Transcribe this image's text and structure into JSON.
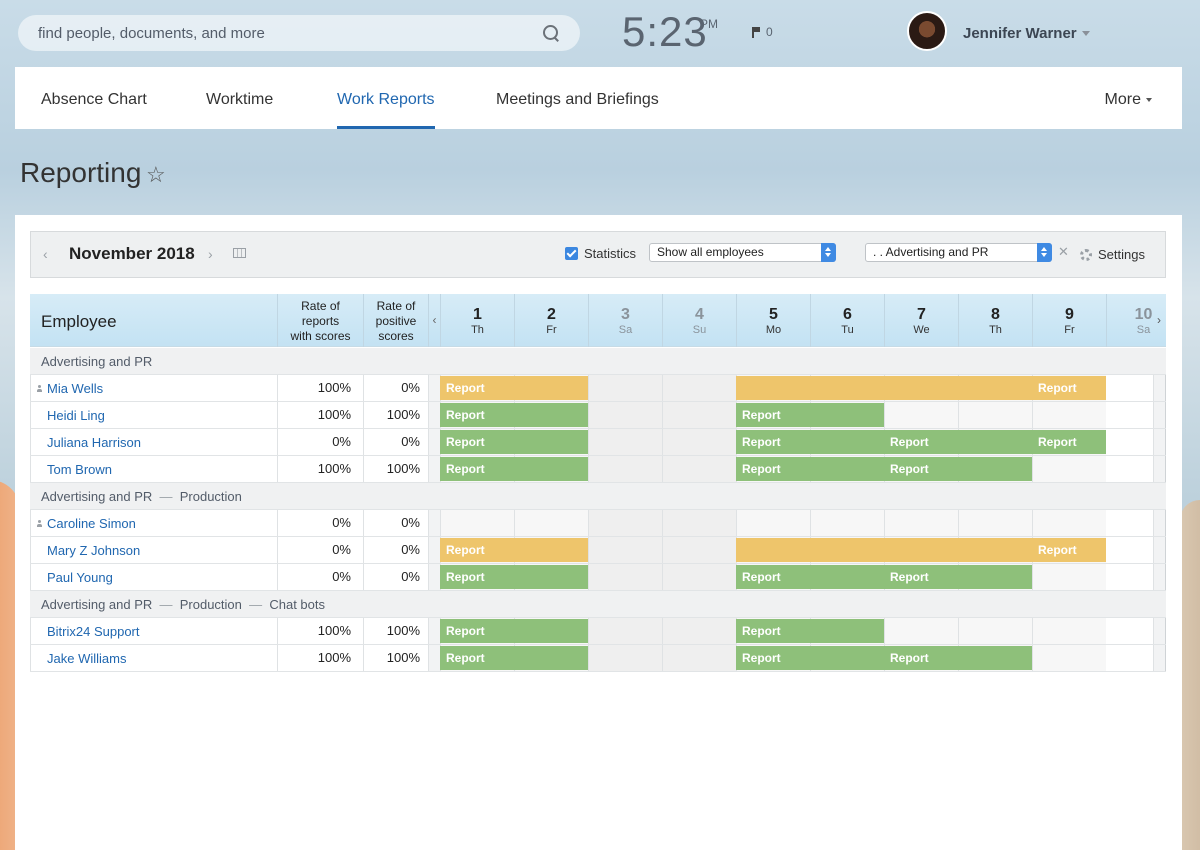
{
  "header": {
    "search_placeholder": "find people, documents, and more",
    "clock_time": "5:23",
    "clock_ampm": "PM",
    "flag_count": "0",
    "user_name": "Jennifer Warner"
  },
  "nav": {
    "tabs": [
      {
        "label": "Absence Chart",
        "active": false
      },
      {
        "label": "Worktime",
        "active": false
      },
      {
        "label": "Work Reports",
        "active": true
      },
      {
        "label": "Meetings and Briefings",
        "active": false
      }
    ],
    "more_label": "More"
  },
  "page": {
    "title": "Reporting"
  },
  "toolbar": {
    "month": "November 2018",
    "statistics_label": "Statistics",
    "statistics_checked": true,
    "employees_select": "Show all employees",
    "department_select": ". . Advertising and PR",
    "settings_label": "Settings"
  },
  "grid": {
    "employee_header": "Employee",
    "col1_header": [
      "Rate of",
      "reports",
      "with scores"
    ],
    "col2_header": [
      "Rate of",
      "positive",
      "scores"
    ],
    "days": [
      {
        "num": "1",
        "name": "Th",
        "weekend": false
      },
      {
        "num": "2",
        "name": "Fr",
        "weekend": false
      },
      {
        "num": "3",
        "name": "Sa",
        "weekend": true
      },
      {
        "num": "4",
        "name": "Su",
        "weekend": true
      },
      {
        "num": "5",
        "name": "Mo",
        "weekend": false
      },
      {
        "num": "6",
        "name": "Tu",
        "weekend": false
      },
      {
        "num": "7",
        "name": "We",
        "weekend": false
      },
      {
        "num": "8",
        "name": "Th",
        "weekend": false
      },
      {
        "num": "9",
        "name": "Fr",
        "weekend": false
      },
      {
        "num": "10",
        "name": "Sa",
        "weekend": true
      }
    ],
    "rows": [
      {
        "type": "group",
        "parts": [
          "Advertising and PR"
        ]
      },
      {
        "type": "emp",
        "name": "Mia Wells",
        "head": true,
        "rate": "100%",
        "positive": "0%",
        "bars": [
          {
            "from": 0,
            "span": 2,
            "color": "yellow",
            "label": "Report"
          },
          {
            "from": 4,
            "span": 4,
            "color": "yellow",
            "label": ""
          },
          {
            "from": 8,
            "span": 1,
            "color": "yellow",
            "label": "Report"
          }
        ]
      },
      {
        "type": "emp",
        "name": "Heidi Ling",
        "head": false,
        "rate": "100%",
        "positive": "100%",
        "bars": [
          {
            "from": 0,
            "span": 2,
            "color": "green",
            "label": "Report"
          },
          {
            "from": 4,
            "span": 2,
            "color": "green",
            "label": "Report"
          }
        ]
      },
      {
        "type": "emp",
        "name": "Juliana Harrison",
        "head": false,
        "rate": "0%",
        "positive": "0%",
        "bars": [
          {
            "from": 0,
            "span": 2,
            "color": "green",
            "label": "Report"
          },
          {
            "from": 4,
            "span": 2,
            "color": "green",
            "label": "Report"
          },
          {
            "from": 6,
            "span": 2,
            "color": "green",
            "label": "Report"
          },
          {
            "from": 8,
            "span": 1,
            "color": "green",
            "label": "Report"
          }
        ]
      },
      {
        "type": "emp",
        "name": "Tom Brown",
        "head": false,
        "rate": "100%",
        "positive": "100%",
        "bars": [
          {
            "from": 0,
            "span": 2,
            "color": "green",
            "label": "Report"
          },
          {
            "from": 4,
            "span": 2,
            "color": "green",
            "label": "Report"
          },
          {
            "from": 6,
            "span": 2,
            "color": "green",
            "label": "Report"
          }
        ]
      },
      {
        "type": "group",
        "parts": [
          "Advertising and PR",
          "Production"
        ]
      },
      {
        "type": "emp",
        "name": "Caroline Simon",
        "head": true,
        "rate": "0%",
        "positive": "0%",
        "bars": []
      },
      {
        "type": "emp",
        "name": "Mary Z Johnson",
        "head": false,
        "rate": "0%",
        "positive": "0%",
        "bars": [
          {
            "from": 0,
            "span": 2,
            "color": "yellow",
            "label": "Report"
          },
          {
            "from": 4,
            "span": 4,
            "color": "yellow",
            "label": ""
          },
          {
            "from": 8,
            "span": 1,
            "color": "yellow",
            "label": "Report"
          }
        ]
      },
      {
        "type": "emp",
        "name": "Paul Young",
        "head": false,
        "rate": "0%",
        "positive": "0%",
        "bars": [
          {
            "from": 0,
            "span": 2,
            "color": "green",
            "label": "Report"
          },
          {
            "from": 4,
            "span": 2,
            "color": "green",
            "label": "Report"
          },
          {
            "from": 6,
            "span": 2,
            "color": "green",
            "label": "Report"
          }
        ]
      },
      {
        "type": "group",
        "parts": [
          "Advertising and PR",
          "Production",
          "Chat bots"
        ]
      },
      {
        "type": "emp",
        "name": "Bitrix24 Support",
        "head": false,
        "rate": "100%",
        "positive": "100%",
        "bars": [
          {
            "from": 0,
            "span": 2,
            "color": "green",
            "label": "Report"
          },
          {
            "from": 4,
            "span": 2,
            "color": "green",
            "label": "Report"
          }
        ]
      },
      {
        "type": "emp",
        "name": "Jake Williams",
        "head": false,
        "rate": "100%",
        "positive": "100%",
        "bars": [
          {
            "from": 0,
            "span": 2,
            "color": "green",
            "label": "Report"
          },
          {
            "from": 4,
            "span": 2,
            "color": "green",
            "label": "Report"
          },
          {
            "from": 6,
            "span": 2,
            "color": "green",
            "label": "Report"
          }
        ]
      }
    ]
  },
  "colors": {
    "accent": "#2067b0",
    "report_green": "#8ec07a",
    "report_yellow": "#eec56b",
    "checkbox_blue": "#3b87e0"
  },
  "icons": [
    "search-icon",
    "flag-icon",
    "chevron-down-icon",
    "star-icon",
    "chevron-left-icon",
    "chevron-right-icon",
    "calendar-icon",
    "gear-icon",
    "close-icon",
    "person-icon"
  ]
}
